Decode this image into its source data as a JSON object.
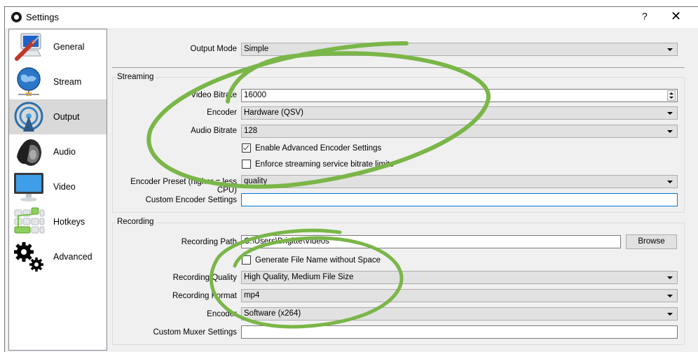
{
  "window": {
    "title": "Settings",
    "help_label": "?",
    "close_label": "✕"
  },
  "sidebar": {
    "items": [
      {
        "label": "General",
        "icon": "computer-screwdriver-icon",
        "active": false
      },
      {
        "label": "Stream",
        "icon": "globe-network-icon",
        "active": false
      },
      {
        "label": "Output",
        "icon": "broadcast-antenna-icon",
        "active": true
      },
      {
        "label": "Audio",
        "icon": "speaker-icon",
        "active": false
      },
      {
        "label": "Video",
        "icon": "monitor-icon",
        "active": false
      },
      {
        "label": "Hotkeys",
        "icon": "keyboard-icon",
        "active": false
      },
      {
        "label": "Advanced",
        "icon": "gears-icon",
        "active": false
      }
    ]
  },
  "output_mode": {
    "label": "Output Mode",
    "value": "Simple"
  },
  "streaming": {
    "group_title": "Streaming",
    "video_bitrate": {
      "label": "Video Bitrate",
      "value": "16000"
    },
    "encoder": {
      "label": "Encoder",
      "value": "Hardware (QSV)"
    },
    "audio_bitrate": {
      "label": "Audio Bitrate",
      "value": "128"
    },
    "enable_advanced": {
      "label": "Enable Advanced Encoder Settings",
      "checked": true
    },
    "enforce_limits": {
      "label": "Enforce streaming service bitrate limits",
      "checked": false
    },
    "encoder_preset": {
      "label": "Encoder Preset (higher = less CPU)",
      "value": "quality"
    },
    "custom_encoder_settings": {
      "label": "Custom Encoder Settings",
      "value": ""
    }
  },
  "recording": {
    "group_title": "Recording",
    "recording_path": {
      "label": "Recording Path",
      "value": "C:\\Users\\Brigitte\\Videos"
    },
    "browse_label": "Browse",
    "generate_filename": {
      "label": "Generate File Name without Space",
      "checked": false
    },
    "recording_quality": {
      "label": "Recording Quality",
      "value": "High Quality, Medium File Size"
    },
    "recording_format": {
      "label": "Recording Format",
      "value": "mp4"
    },
    "encoder": {
      "label": "Encoder",
      "value": "Software (x264)"
    },
    "custom_muxer_settings": {
      "label": "Custom Muxer Settings",
      "value": ""
    }
  },
  "annotation": {
    "color": "#7ab648"
  }
}
